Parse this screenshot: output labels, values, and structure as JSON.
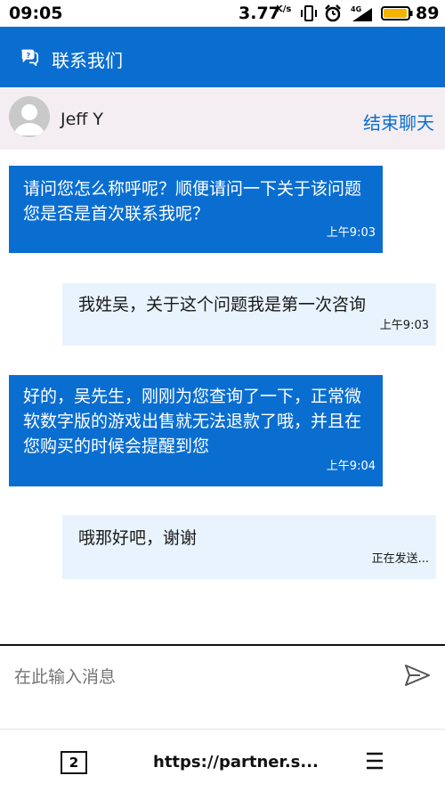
{
  "status_bar": {
    "time": "09:05",
    "speed": "3.77",
    "speed_unit": "K/s",
    "battery": "89"
  },
  "header": {
    "title": "联系我们",
    "icon": "chat-bubbles-icon"
  },
  "agent": {
    "name": "Jeff Y",
    "end_chat_label": "结束聊天"
  },
  "messages": [
    {
      "direction": "incoming",
      "text": "请问您怎么称呼呢？顺便请问一下关于该问题您是否是首次联系我呢？",
      "time": "上午9:03"
    },
    {
      "direction": "outgoing",
      "text": "我姓吴，关于这个问题我是第一次咨询",
      "time": "上午9:03"
    },
    {
      "direction": "incoming",
      "text": "好的，吴先生，刚刚为您查询了一下，正常微软数字版的游戏出售就无法退款了哦，并且在您购买的时候会提醒到您",
      "time": "上午9:04"
    },
    {
      "direction": "outgoing",
      "text": "哦那好吧，谢谢",
      "time": "正在发送..."
    }
  ],
  "composer": {
    "placeholder": "在此输入消息"
  },
  "browser": {
    "tab_count": "2",
    "url": "https://partner.s..."
  },
  "colors": {
    "brand_blue": "#0a6ed1",
    "outgoing_bubble": "#e9f3fd",
    "agent_bar": "#f4eef3"
  }
}
